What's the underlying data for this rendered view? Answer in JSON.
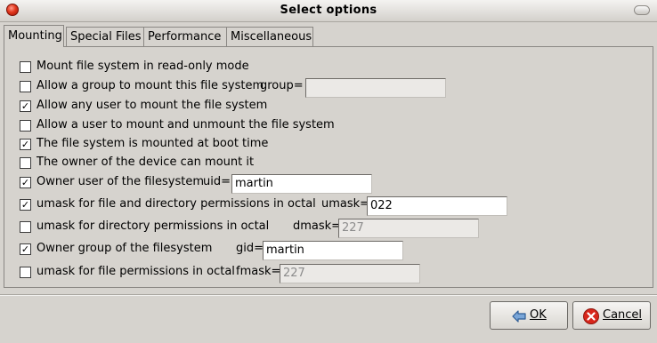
{
  "window": {
    "title": "Select options"
  },
  "tabs": [
    {
      "label": "Mounting",
      "active": true
    },
    {
      "label": "Special Files",
      "active": false
    },
    {
      "label": "Performance",
      "active": false
    },
    {
      "label": "Miscellaneous",
      "active": false
    }
  ],
  "options": [
    {
      "label": "Mount file system in read-only mode",
      "checked": false
    },
    {
      "label": "Allow a group to mount this file system",
      "checked": false,
      "param_label": "group=",
      "value": "",
      "enabled": false
    },
    {
      "label": "Allow any user to mount the file system",
      "checked": true
    },
    {
      "label": "Allow a user to mount and unmount the file system",
      "checked": false
    },
    {
      "label": "The file system is mounted at boot time",
      "checked": true
    },
    {
      "label": "The owner of the device can mount it",
      "checked": false
    },
    {
      "label": "Owner user of the filesystem",
      "checked": true,
      "param_label": "uid=",
      "value": "martin",
      "enabled": true
    },
    {
      "label": "umask for file and directory permissions in octal",
      "checked": true,
      "param_label": "umask=",
      "value": "022",
      "enabled": true
    },
    {
      "label": "umask for directory permissions in octal",
      "checked": false,
      "param_label": "dmask=",
      "value": "227",
      "enabled": false
    },
    {
      "label": "Owner group of the filesystem",
      "checked": true,
      "param_label": "gid=",
      "value": "martin",
      "enabled": true
    },
    {
      "label": "umask for file permissions in octal",
      "checked": false,
      "param_label": "fmask=",
      "value": "227",
      "enabled": false
    }
  ],
  "buttons": {
    "ok": {
      "label": "OK",
      "icon": "back-arrow-icon"
    },
    "cancel": {
      "label": "Cancel",
      "icon": "cancel-icon"
    }
  }
}
